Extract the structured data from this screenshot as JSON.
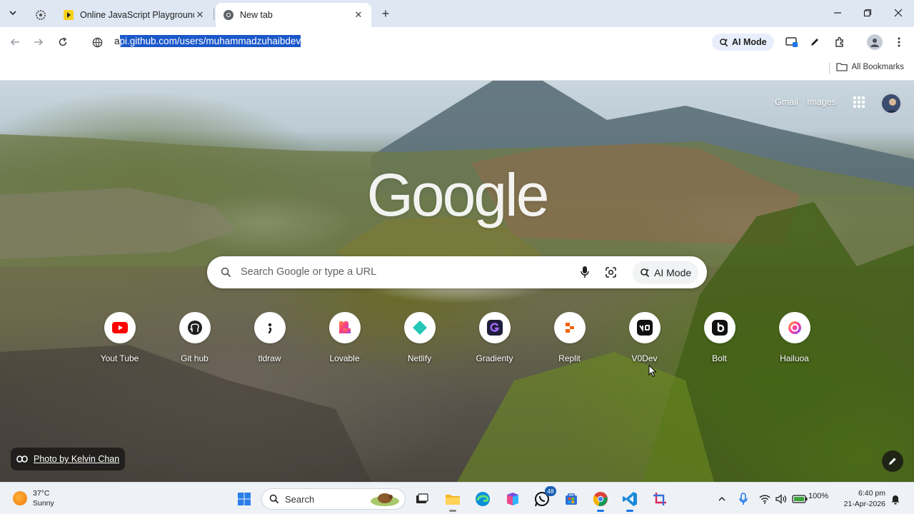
{
  "browser": {
    "tabs": [
      {
        "title": "Online JavaScript Playground",
        "active": false
      },
      {
        "title": "New tab",
        "active": true
      }
    ],
    "address_bar": {
      "url_prefix": "a",
      "url_selected": "pi.github.com/users/muhammadzuhaibdev"
    },
    "toolbar": {
      "ai_mode_label": "AI Mode"
    },
    "bookmarks_bar": {
      "all_bookmarks_label": "All Bookmarks"
    }
  },
  "ntp": {
    "header_links": {
      "gmail": "Gmail",
      "images": "Images"
    },
    "logo_text": "Google",
    "search": {
      "placeholder": "Search Google or type a URL",
      "ai_mode_label": "AI Mode"
    },
    "shortcuts": [
      {
        "label": "Yout Tube",
        "icon": "youtube-icon"
      },
      {
        "label": "Git hub",
        "icon": "github-icon"
      },
      {
        "label": "tldraw",
        "icon": "tldraw-icon"
      },
      {
        "label": "Lovable",
        "icon": "lovable-icon"
      },
      {
        "label": "Netlify",
        "icon": "netlify-icon"
      },
      {
        "label": "Gradienty",
        "icon": "gradienty-icon"
      },
      {
        "label": "Replit",
        "icon": "replit-icon"
      },
      {
        "label": "V0Dev",
        "icon": "v0-icon"
      },
      {
        "label": "Bolt",
        "icon": "bolt-icon"
      },
      {
        "label": "Hailuoa",
        "icon": "hailuo-icon"
      }
    ],
    "photo_credit": "Photo by Kelvin Chan"
  },
  "taskbar": {
    "weather": {
      "temp": "37°C",
      "condition": "Sunny"
    },
    "search_label": "Search",
    "whatsapp_badge": "48",
    "battery": "100%",
    "time": "6:40 pm",
    "date": "21-Apr-2026"
  },
  "colors": {
    "accent": "#1a57c9",
    "tab_strip": "#dfe7f3",
    "taskbar": "#eef1f6"
  }
}
